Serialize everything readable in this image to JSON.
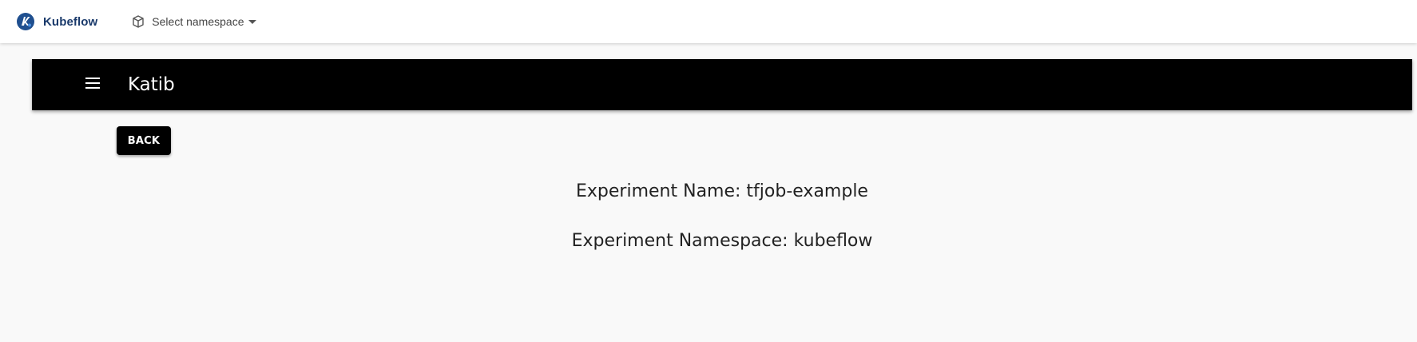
{
  "topbar": {
    "brand_name": "Kubeflow",
    "brand_icon": "kubeflow-logo-icon",
    "namespace_selector": {
      "label": "Select namespace",
      "icon": "cube-icon"
    }
  },
  "app_bar": {
    "title": "Katib",
    "menu_icon": "hamburger-menu-icon",
    "background": "#000000"
  },
  "actions": {
    "back_label": "BACK"
  },
  "experiment": {
    "name_line": "Experiment Name: tfjob-example",
    "namespace_line": "Experiment Namespace: kubeflow"
  },
  "colors": {
    "brand_text": "#1a3a6b",
    "page_background": "#f9f9f9"
  }
}
